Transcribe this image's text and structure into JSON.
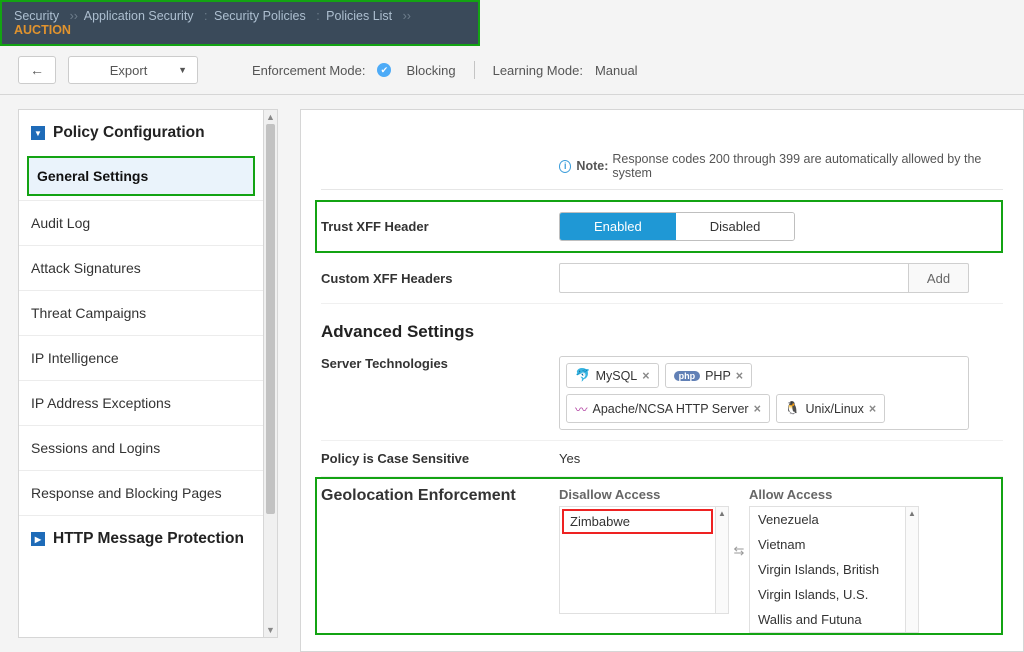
{
  "breadcrumb": {
    "root": "Security",
    "p1": "Application Security",
    "sep_colon": ":",
    "p2": "Security Policies",
    "p3": "Policies List",
    "current": "AUCTION",
    "arrow": "››"
  },
  "toolbar": {
    "export": "Export",
    "enf_mode_label": "Enforcement Mode:",
    "enf_mode_value": "Blocking",
    "learn_mode_label": "Learning Mode:",
    "learn_mode_value": "Manual"
  },
  "sidebar": {
    "section1": "Policy Configuration",
    "items": [
      "General Settings",
      "Audit Log",
      "Attack Signatures",
      "Threat Campaigns",
      "IP Intelligence",
      "IP Address Exceptions",
      "Sessions and Logins",
      "Response and Blocking Pages"
    ],
    "section2": "HTTP Message Protection"
  },
  "main": {
    "note_label": "Note:",
    "note_text": "Response codes 200 through 399 are automatically allowed by the system",
    "trust_xff_label": "Trust XFF Header",
    "enabled": "Enabled",
    "disabled": "Disabled",
    "custom_xff_label": "Custom XFF Headers",
    "add": "Add",
    "advanced_h": "Advanced Settings",
    "server_tech_label": "Server Technologies",
    "tags": {
      "mysql": "MySQL",
      "php": "PHP",
      "apache": "Apache/NCSA HTTP Server",
      "unix": "Unix/Linux"
    },
    "case_label": "Policy is Case Sensitive",
    "case_val": "Yes",
    "geo_label": "Geolocation Enforcement",
    "disallow_h": "Disallow Access",
    "allow_h": "Allow Access",
    "disallow_items": [
      "Zimbabwe"
    ],
    "allow_items": [
      "Venezuela",
      "Vietnam",
      "Virgin Islands, British",
      "Virgin Islands, U.S.",
      "Wallis and Futuna"
    ]
  }
}
